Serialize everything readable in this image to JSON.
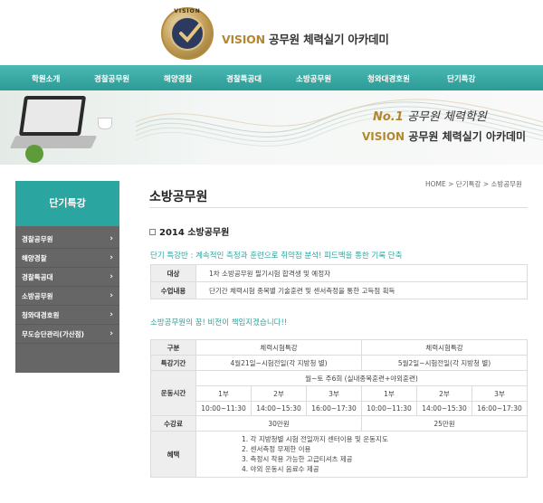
{
  "header": {
    "logo_top_text": "VISION",
    "brand_accent": "VISION",
    "brand_text": "공무원 체력실기 아카데미"
  },
  "nav": {
    "items": [
      "학원소개",
      "경찰공무원",
      "해양경찰",
      "경찰특공대",
      "소방공무원",
      "청와대경호원",
      "단기특강"
    ]
  },
  "hero": {
    "line1_no": "No.1",
    "line1_text": "공무원 체력학원",
    "line2_accent": "VISION",
    "line2_text": "공무원 체력실기 아카데미"
  },
  "sidebar": {
    "title": "단기특강",
    "items": [
      "경찰공무원",
      "해양경찰",
      "경찰특공대",
      "소방공무원",
      "청와대경호원",
      "무도승단관리(가산점)"
    ]
  },
  "page": {
    "title": "소방공무원",
    "breadcrumb": "HOME > 단기특강 > 소방공무원",
    "section_title": "2014 소방공무원",
    "intro": "단기 특강반 : 계속적인 측정과 훈련으로 취약점 분석! 피드백을 통한 기록 단축",
    "info_rows": [
      {
        "key": "대상",
        "value": "1차 소방공무원 필기시험 합격생 및 예정자"
      },
      {
        "key": "수업내용",
        "value": "단기간 체력시험 종목별 기술훈련 및 센서측정을 통한 고득점 획득"
      }
    ],
    "dream": "소방공무원의 꿈! 비전이 책임지겠습니다!!"
  },
  "schedule": {
    "label_category": "구분",
    "col_a": "체력시험특강",
    "col_b": "체력시험특강",
    "label_period": "특강기간",
    "period_a": "4월21일~시험전일(각 지방청 별)",
    "period_b": "5월2일~시험전일(각 지방청 별)",
    "label_time": "운동시간",
    "days": "월~토 주6회 (실내종목훈련+야외훈련)",
    "parts": [
      "1부",
      "2부",
      "3부",
      "1부",
      "2부",
      "3부"
    ],
    "times": [
      "10:00~11:30",
      "14:00~15:30",
      "16:00~17:30",
      "10:00~11:30",
      "14:00~15:30",
      "16:00~17:30"
    ],
    "label_fee": "수강료",
    "fee_a": "30만원",
    "fee_b": "25만원",
    "label_benefit": "혜택",
    "benefits": [
      "1. 각 지방청별 시험 전일까지 센터이용 및 운동지도",
      "2. 센서측정 무제한 이용",
      "3. 측정시 착용 가능한 고급티셔츠 제공",
      "4. 야외 운동시 음료수 제공"
    ]
  },
  "colors": {
    "accent_teal": "#2aa59f",
    "gold": "#b2882f",
    "sidebar_bg": "#666666"
  }
}
